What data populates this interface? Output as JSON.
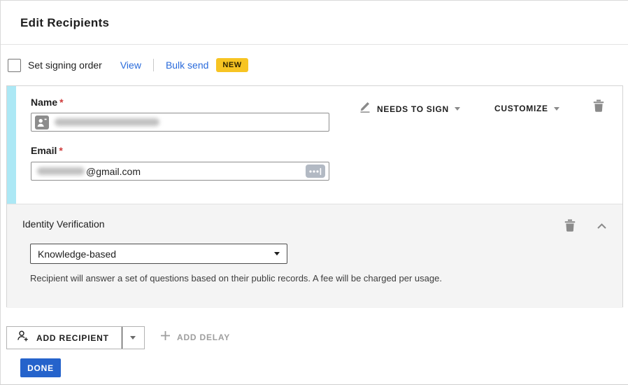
{
  "header": {
    "title": "Edit Recipients"
  },
  "signing_order": {
    "label": "Set signing order",
    "view_link": "View",
    "bulk_send_link": "Bulk send",
    "new_badge": "NEW"
  },
  "recipient": {
    "name_label": "Name",
    "required_mark": "*",
    "email_label": "Email",
    "email_domain": "@gmail.com",
    "role_action": "NEEDS TO SIGN",
    "customize": "CUSTOMIZE"
  },
  "identity_verification": {
    "title": "Identity Verification",
    "selected_option": "Knowledge-based",
    "description": "Recipient will answer a set of questions based on their public records. A fee will be charged per usage."
  },
  "footer": {
    "add_recipient": "ADD RECIPIENT",
    "add_delay": "ADD DELAY",
    "done": "DONE"
  },
  "colors": {
    "accent_blue": "#2563cb",
    "link_blue": "#2a6bdb",
    "badge_yellow": "#f7c423",
    "cyan_strip": "#ace8f5",
    "icon_gray": "#8a8a8a"
  }
}
